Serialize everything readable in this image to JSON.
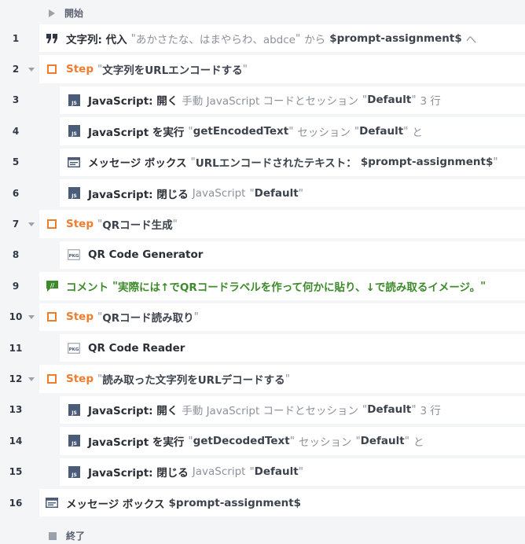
{
  "start_label": "開始",
  "end_label": "終了",
  "rows": [
    {
      "num": "1",
      "parts": {
        "action": "文字列: 代入",
        "q1": "\"",
        "val1": "あかさたな、はまやらわ、abdce",
        "q2": "\"",
        "from": "から",
        "var": "$prompt-assignment$",
        "to": "へ"
      }
    },
    {
      "num": "2",
      "parts": {
        "step": "Step",
        "q1": "\"",
        "title": "文字列をURLエンコードする",
        "q2": "\""
      }
    },
    {
      "num": "3",
      "parts": {
        "action": "JavaScript: 開く",
        "mid": "手動 JavaScript コードとセッション",
        "q1": "\"",
        "val": "Default",
        "q2": "\"",
        "tail": "3 行"
      }
    },
    {
      "num": "4",
      "parts": {
        "action": "JavaScript を実行",
        "q1": "\"",
        "val": "getEncodedText",
        "q2": "\"",
        "mid": "セッション",
        "q3": "\"",
        "val2": "Default",
        "q4": "\"",
        "tail": "と"
      }
    },
    {
      "num": "5",
      "parts": {
        "action": "メッセージ ボックス",
        "q1": "\"",
        "val": "URLエンコードされたテキスト：",
        "var": "$prompt-assignment$",
        "q2": "\""
      }
    },
    {
      "num": "6",
      "parts": {
        "action": "JavaScript: 閉じる",
        "mid": "JavaScript",
        "q1": "\"",
        "val": "Default",
        "q2": "\""
      }
    },
    {
      "num": "7",
      "parts": {
        "step": "Step",
        "q1": "\"",
        "title": "QRコード生成",
        "q2": "\""
      }
    },
    {
      "num": "8",
      "parts": {
        "action": "QR Code Generator"
      }
    },
    {
      "num": "9",
      "parts": {
        "comment": "コメント",
        "q1": "\"",
        "text": "実際には↑でQRコードラベルを作って何かに貼り、↓で読み取るイメージ。",
        "q2": "\""
      }
    },
    {
      "num": "10",
      "parts": {
        "step": "Step",
        "q1": "\"",
        "title": "QRコード読み取り",
        "q2": "\""
      }
    },
    {
      "num": "11",
      "parts": {
        "action": "QR Code Reader"
      }
    },
    {
      "num": "12",
      "parts": {
        "step": "Step",
        "q1": "\"",
        "title": "読み取った文字列をURLデコードする",
        "q2": "\""
      }
    },
    {
      "num": "13",
      "parts": {
        "action": "JavaScript: 開く",
        "mid": "手動 JavaScript コードとセッション",
        "q1": "\"",
        "val": "Default",
        "q2": "\"",
        "tail": "3 行"
      }
    },
    {
      "num": "14",
      "parts": {
        "action": "JavaScript を実行",
        "q1": "\"",
        "val": "getDecodedText",
        "q2": "\"",
        "mid": "セッション",
        "q3": "\"",
        "val2": "Default",
        "q4": "\"",
        "tail": "と"
      }
    },
    {
      "num": "15",
      "parts": {
        "action": "JavaScript: 閉じる",
        "mid": "JavaScript",
        "q1": "\"",
        "val": "Default",
        "q2": "\""
      }
    },
    {
      "num": "16",
      "parts": {
        "action": "メッセージ ボックス",
        "var": "$prompt-assignment$"
      }
    }
  ],
  "icons": {
    "assign": "quote-icon",
    "step": "step-box-icon",
    "js": "javascript-icon",
    "msg": "message-box-icon",
    "pkg": "package-icon",
    "comment": "comment-icon",
    "start": "play-icon",
    "end": "stop-icon"
  },
  "colors": {
    "step": "#ef7d2e",
    "comment": "#3c8a2a",
    "js": "#4a5c78",
    "bg": "#f4f5f7",
    "card": "#ffffff"
  }
}
